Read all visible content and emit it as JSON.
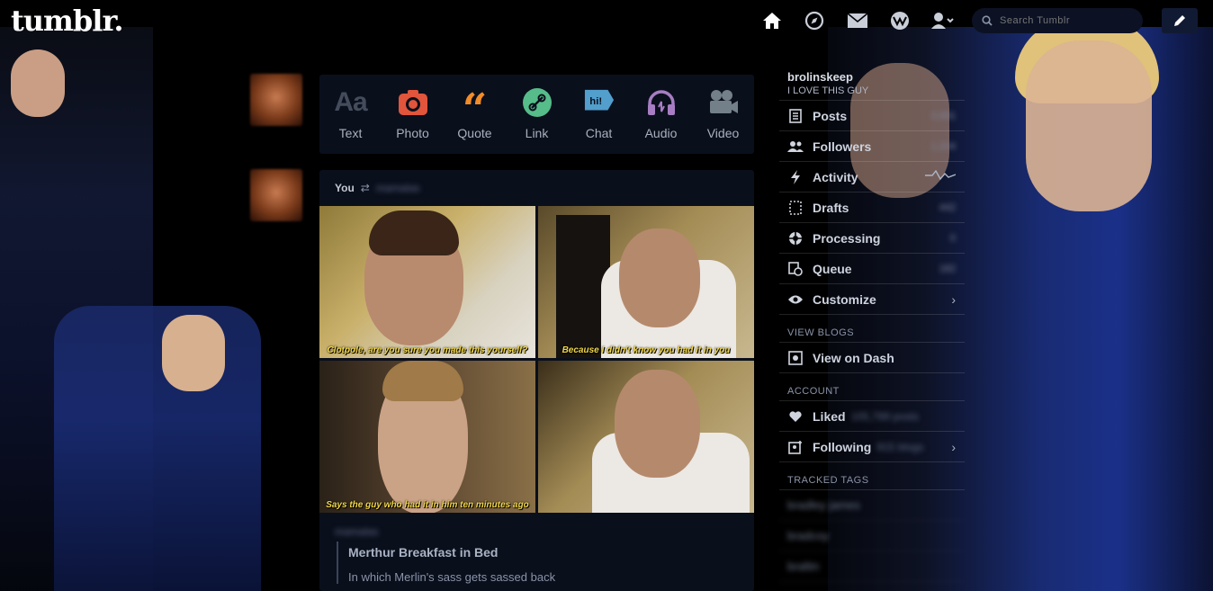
{
  "header": {
    "logo": "tumblr.",
    "nav_icons": [
      "home-icon",
      "explore-icon",
      "inbox-icon",
      "activity-icon",
      "account-icon"
    ],
    "search_placeholder": "Search Tumblr",
    "compose_icon": "pencil-icon"
  },
  "post_types": [
    {
      "label": "Text",
      "icon": "text-icon",
      "color": "#444c5c"
    },
    {
      "label": "Photo",
      "icon": "camera-icon",
      "color": "#e0553b"
    },
    {
      "label": "Quote",
      "icon": "quote-icon",
      "color": "#f28c28"
    },
    {
      "label": "Link",
      "icon": "link-icon",
      "color": "#56bc8a"
    },
    {
      "label": "Chat",
      "icon": "chat-icon",
      "color": "#529ecc"
    },
    {
      "label": "Audio",
      "icon": "headphones-icon",
      "color": "#a77dc2"
    },
    {
      "label": "Video",
      "icon": "video-icon",
      "color": "#748089"
    }
  ],
  "post": {
    "you": "You",
    "reblogged_from": "mamalas",
    "gifs": [
      {
        "caption": "Clotpole, are you sure you made this yourself?"
      },
      {
        "caption": "Because I didn't know you had it in you"
      },
      {
        "caption": "Says the guy who had it in him ten minutes ago"
      },
      {
        "caption": ""
      }
    ],
    "source_user": "mamalas",
    "title": "Merthur Breakfast in Bed",
    "description": "In which Merlin's sass gets sassed back"
  },
  "sidebar": {
    "blog_name": "brolinskeep",
    "tagline": "I LOVE THIS GUY",
    "items": [
      {
        "label": "Posts",
        "count": "3,981",
        "icon": "posts-icon"
      },
      {
        "label": "Followers",
        "count": "1,204",
        "icon": "followers-icon"
      },
      {
        "label": "Activity",
        "count": "",
        "icon": "activity-bolt-icon"
      },
      {
        "label": "Drafts",
        "count": "442",
        "icon": "drafts-icon"
      },
      {
        "label": "Processing",
        "count": "0",
        "icon": "processing-icon"
      },
      {
        "label": "Queue",
        "count": "182",
        "icon": "queue-icon"
      },
      {
        "label": "Customize",
        "count": "",
        "icon": "eye-icon"
      }
    ],
    "view_blogs_heading": "VIEW BLOGS",
    "view_on_dash": "View on Dash",
    "account_heading": "ACCOUNT",
    "liked_label": "Liked",
    "liked_count": "105,789 posts",
    "following_label": "Following",
    "following_count": "915 blogs",
    "tracked_tags_heading": "TRACKED TAGS",
    "tracked_tags": [
      "bradley james",
      "bradcoy",
      "braltin"
    ]
  }
}
